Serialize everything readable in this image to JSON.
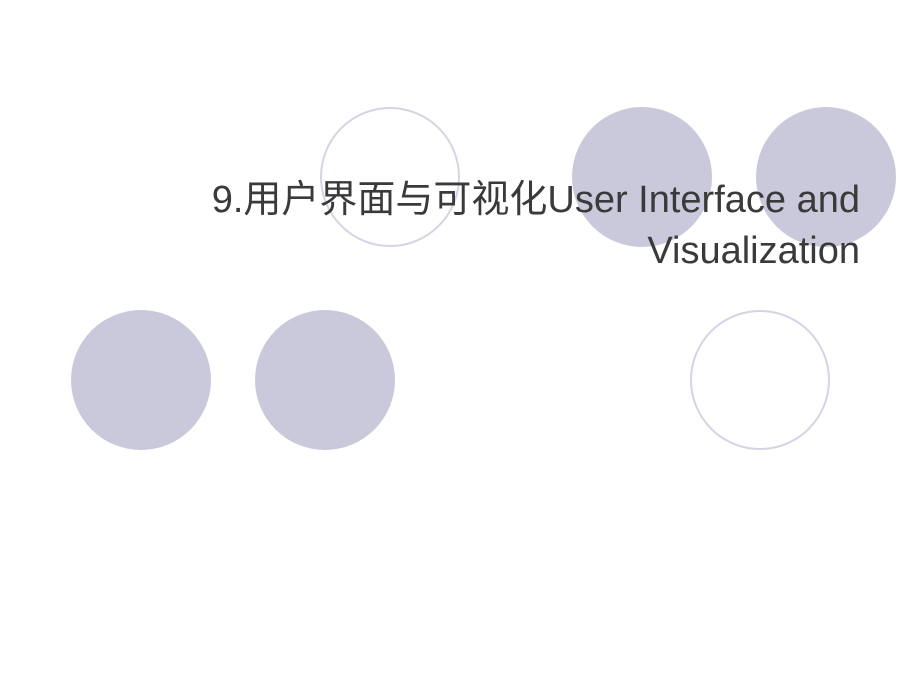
{
  "slide": {
    "title": "9.用户界面与可视化User Interface and Visualization"
  }
}
